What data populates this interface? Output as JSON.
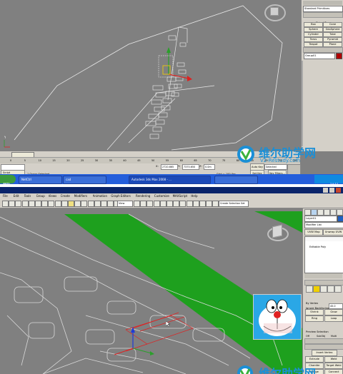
{
  "top": {
    "command_panel": {
      "dropdown": "Standard Primitives",
      "object_type_title": "Object Type",
      "autogrid": "AutoGrid",
      "primitives": [
        "Box",
        "Cone",
        "Sphere",
        "GeoSphere",
        "Cylinder",
        "Tube",
        "Torus",
        "Pyramid",
        "Teapot",
        "Plane"
      ],
      "name_color_title": "Name and Color",
      "name_value": "Group01"
    },
    "viewport": {
      "axis_label": "Y"
    },
    "timeline": {
      "frame_label": "0 / 100",
      "ticks": [
        "0",
        "5",
        "10",
        "15",
        "20",
        "25",
        "30",
        "35",
        "40",
        "45",
        "50",
        "55",
        "60",
        "65",
        "70",
        "75",
        "80",
        "85",
        "90",
        "95",
        "100"
      ]
    },
    "status": {
      "selection": "1 Group Selected",
      "prompt": "Click and drag to select and move objects",
      "x_label": "X:",
      "x_value": "2720.665",
      "y_label": "Y:",
      "y_value": "7370.650",
      "z_label": "Z:",
      "z_value": "0.0m",
      "grid": "Grid = 100.0m",
      "add_time_tag": "Add Time Tag",
      "auto_key": "Auto Key",
      "selected": "Selected",
      "set_key": "Set Key",
      "key_filters": "Key Filters...",
      "maxscript": "Script"
    },
    "taskbar": {
      "start": "开始",
      "items": [
        "NetCtrl",
        "cad",
        "Autodesk 3ds Max 2008 - ...",
        ""
      ],
      "clock": "14:11"
    },
    "watermark": {
      "cn": "维尔助学网",
      "url": "V2-Restudy.com"
    }
  },
  "bottom": {
    "title": {
      "left": "Untitled   - Project Folder: d:\\My Documents\\3dsmax    - Autodesk 3ds Max 2008    - Display : Direct 3D"
    },
    "menu": [
      "File",
      "Edit",
      "Tools",
      "Group",
      "Views",
      "Create",
      "Modifiers",
      "Animation",
      "Graph Editors",
      "Rendering",
      "Customize",
      "MAXScript",
      "Help"
    ],
    "toolbar": {
      "view_dropdown": "View",
      "selection_set": "Create Selection Set"
    },
    "command_panel": {
      "name_value": "Layer01",
      "modifier_list": "Modifier List",
      "uvw_map": "UVW Map",
      "unwrap_uvw": "Unwrap UVW",
      "stack_item": "Editable Poly",
      "selection_title": "Selection",
      "by_vertex": "By Vertex",
      "ignore_backfacing": "Ignore Backfacing",
      "by_angle": "By Angle:",
      "angle_value": "45.0",
      "shrink": "Shrink",
      "grow": "Grow",
      "ring": "Ring",
      "loop": "Loop",
      "preview_title": "Preview Selection",
      "off": "Off",
      "subobj": "SubObj",
      "multi": "Multi",
      "count": "4 Edges Selected",
      "soft_title": "Soft Selection",
      "edit_title": "Edit Edges",
      "insert_vertex": "Insert Vertex",
      "extrude": "Extrude",
      "weld": "Weld",
      "chamfer": "Chamfer",
      "target_weld": "Target Weld",
      "bridge": "Bridge",
      "connect": "Connect",
      "create_shape": "Create Shape From Selection"
    },
    "watermark": {
      "cn": "维尔助学网"
    }
  }
}
